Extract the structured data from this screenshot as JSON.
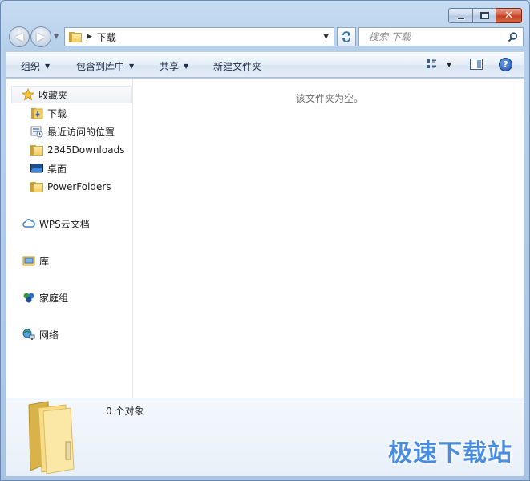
{
  "window": {
    "minimize_label": "",
    "maximize_label": "",
    "close_label": "✕"
  },
  "nav": {
    "back": "◀",
    "forward": "▶",
    "address_separator": "▶",
    "path": "下载",
    "search_placeholder": "搜索 下载"
  },
  "toolbar": {
    "organize": "组织",
    "include_in_library": "包含到库中",
    "share": "共享",
    "new_folder": "新建文件夹",
    "help": "?"
  },
  "sidebar": {
    "favorites": "收藏夹",
    "items": [
      {
        "label": "下载",
        "icon": "downloads-folder-icon"
      },
      {
        "label": "最近访问的位置",
        "icon": "recent-places-icon"
      },
      {
        "label": "2345Downloads",
        "icon": "folder-icon"
      },
      {
        "label": "桌面",
        "icon": "desktop-icon"
      },
      {
        "label": "PowerFolders",
        "icon": "folder-icon"
      }
    ],
    "groups": [
      {
        "label": "WPS云文档",
        "icon": "cloud-icon"
      },
      {
        "label": "库",
        "icon": "library-icon"
      },
      {
        "label": "家庭组",
        "icon": "homegroup-icon"
      },
      {
        "label": "网络",
        "icon": "network-icon"
      }
    ]
  },
  "main": {
    "empty_message": "该文件夹为空。"
  },
  "details": {
    "item_count": "0 个对象",
    "watermark": "极速下载站"
  },
  "colors": {
    "frame": "#b9d1ea",
    "accent": "#4a8de0",
    "close": "#c2401f"
  }
}
